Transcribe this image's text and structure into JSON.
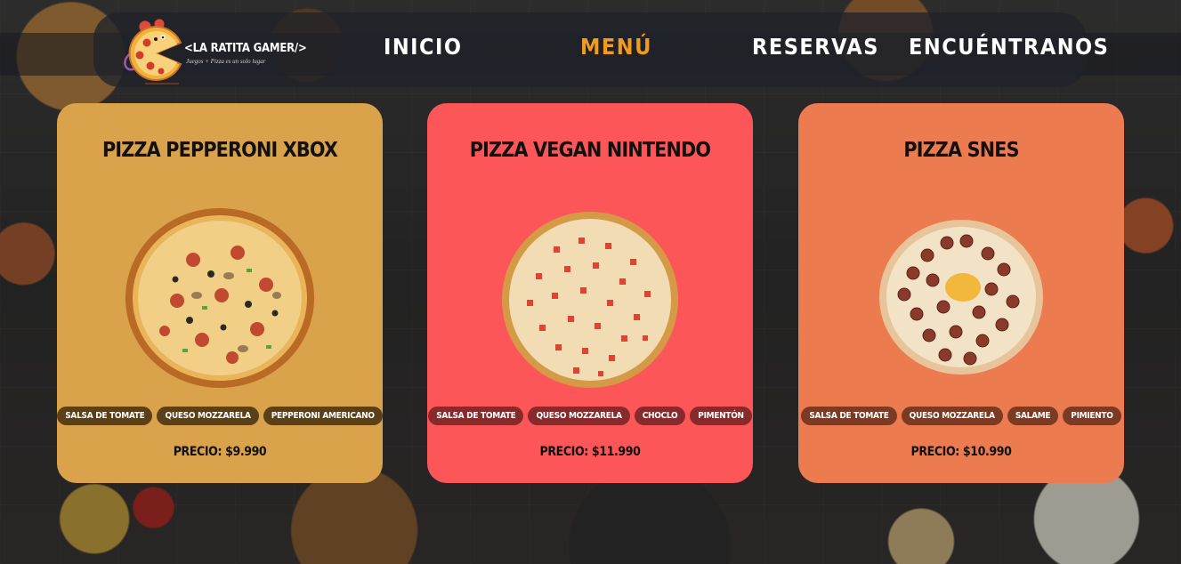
{
  "brand": {
    "name": "<LA RATITA GAMER/>",
    "tagline": "Juegos + Pizza es un solo lugar"
  },
  "nav": {
    "items": [
      {
        "label": "INICIO",
        "active": false
      },
      {
        "label": "MENÚ",
        "active": true
      },
      {
        "label": "RESERVAS",
        "active": false
      },
      {
        "label": "ENCUÉNTRANOS",
        "active": false
      }
    ]
  },
  "colors": {
    "nav_active": "#f29b1d",
    "card_1": "#d9a24b",
    "card_2": "#fc5658",
    "card_3": "#ec7b4f",
    "tag_1": "#5a4019",
    "tag_2": "#862a2c",
    "tag_3": "#7a3a24"
  },
  "menu": {
    "cards": [
      {
        "title": "PIZZA PEPPERONI XBOX",
        "image": "pepperoni-pizza-image",
        "ingredients": [
          "SALSA DE TOMATE",
          "QUESO MOZZARELA",
          "PEPPERONI AMERICANO"
        ],
        "price_label": "PRECIO:",
        "price": "$9.990"
      },
      {
        "title": "PIZZA VEGAN NINTENDO",
        "image": "vegan-pizza-image",
        "ingredients": [
          "SALSA DE TOMATE",
          "QUESO MOZZARELA",
          "CHOCLO",
          "PIMENTÓN"
        ],
        "price_label": "PRECIO:",
        "price": "$11.990"
      },
      {
        "title": "PIZZA SNES",
        "image": "salame-pizza-image",
        "ingredients": [
          "SALSA DE TOMATE",
          "QUESO MOZZARELA",
          "SALAME",
          "PIMIENTO"
        ],
        "price_label": "PRECIO:",
        "price": "$10.990"
      }
    ]
  }
}
